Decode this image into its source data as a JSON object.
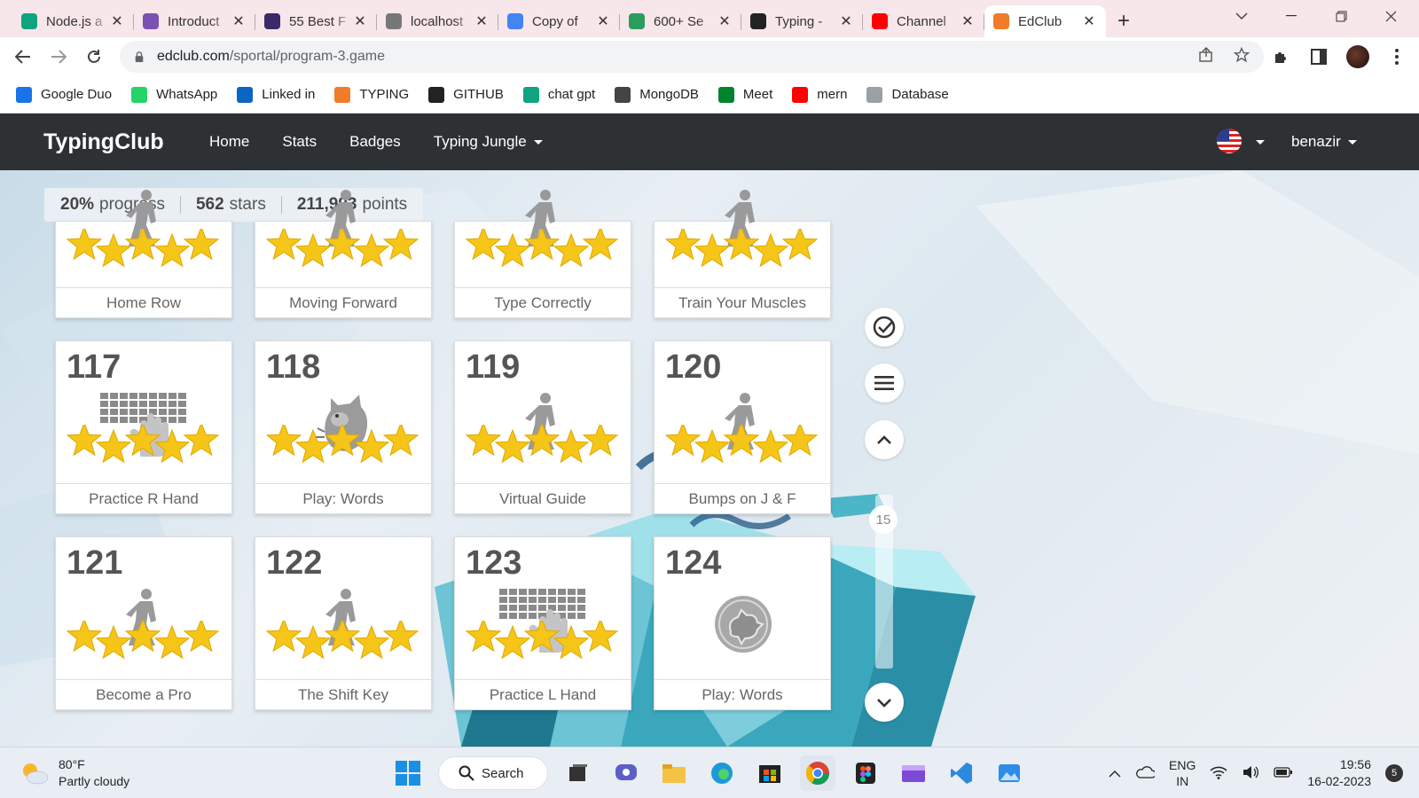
{
  "browser": {
    "tabs": [
      {
        "title": "Node.js a",
        "icon": "chatgpt-icon",
        "color": "#10a37f"
      },
      {
        "title": "Introduct",
        "icon": "bootstrap-icon",
        "color": "#7952b3"
      },
      {
        "title": "55 Best F",
        "icon": "colorlib-icon",
        "color": "#3b2a6b"
      },
      {
        "title": "localhost",
        "icon": "globe-icon",
        "color": "#777777"
      },
      {
        "title": "Copy of",
        "icon": "docs-icon",
        "color": "#4285f4"
      },
      {
        "title": "600+ Se",
        "icon": "feather-icon",
        "color": "#2a9d5c"
      },
      {
        "title": "Typing -",
        "icon": "wikipedia-icon",
        "color": "#222222"
      },
      {
        "title": "Channel",
        "icon": "youtube-icon",
        "color": "#ff0000"
      },
      {
        "title": "EdClub",
        "icon": "edclub-icon",
        "color": "#f07c2a",
        "active": true
      }
    ],
    "address": {
      "host": "edclub.com",
      "path": "/sportal/program-3.game"
    },
    "bookmarks": [
      {
        "label": "Google Duo",
        "icon": "duo-icon",
        "color": "#1a73e8"
      },
      {
        "label": "WhatsApp",
        "icon": "whatsapp-icon",
        "color": "#25d366"
      },
      {
        "label": "Linked in",
        "icon": "linkedin-icon",
        "color": "#0a66c2"
      },
      {
        "label": "TYPING",
        "icon": "edclub-icon",
        "color": "#f07c2a"
      },
      {
        "label": "GITHUB",
        "icon": "github-icon",
        "color": "#222222"
      },
      {
        "label": "chat gpt",
        "icon": "chatgpt-icon",
        "color": "#10a37f"
      },
      {
        "label": "MongoDB",
        "icon": "mongodb-icon",
        "color": "#444444"
      },
      {
        "label": "Meet",
        "icon": "meet-icon",
        "color": "#00832d"
      },
      {
        "label": "mern",
        "icon": "youtube-icon",
        "color": "#ff0000"
      },
      {
        "label": "Database",
        "icon": "bolt-icon",
        "color": "#9aa0a6"
      }
    ]
  },
  "site": {
    "brand": "TypingClub",
    "nav": [
      "Home",
      "Stats",
      "Badges",
      "Typing Jungle"
    ],
    "user": "benazir"
  },
  "stats": {
    "progress_value": "20%",
    "progress_label": "progress",
    "stars_value": "562",
    "stars_label": "stars",
    "points_value": "211,993",
    "points_label": "points"
  },
  "lessons_top_row": [
    {
      "label": "Home Row",
      "stars": 5
    },
    {
      "label": "Moving Forward",
      "stars": 5
    },
    {
      "label": "Type Correctly",
      "stars": 5
    },
    {
      "label": "Train Your Muscles",
      "stars": 5
    }
  ],
  "lessons": [
    {
      "number": "117",
      "label": "Practice R Hand",
      "art": "hand-keyboard",
      "stars": 5
    },
    {
      "number": "118",
      "label": "Play: Words",
      "art": "monster",
      "stars": 5
    },
    {
      "number": "119",
      "label": "Virtual Guide",
      "art": "walker",
      "stars": 5
    },
    {
      "number": "120",
      "label": "Bumps on J & F",
      "art": "walker",
      "stars": 5
    },
    {
      "number": "121",
      "label": "Become a Pro",
      "art": "walker",
      "stars": 5
    },
    {
      "number": "122",
      "label": "The Shift Key",
      "art": "walker",
      "stars": 5
    },
    {
      "number": "123",
      "label": "Practice L Hand",
      "art": "hand-keyboard",
      "stars": 5
    },
    {
      "number": "124",
      "label": "Play: Words",
      "art": "game-badge",
      "stars": 0
    }
  ],
  "scroller": {
    "page": "15"
  },
  "taskbar": {
    "weather_temp": "80°F",
    "weather_desc": "Partly cloudy",
    "search_label": "Search",
    "lang_top": "ENG",
    "lang_bottom": "IN",
    "time": "19:56",
    "date": "16-02-2023",
    "notifications": "5"
  },
  "colors": {
    "nav_bg": "#2d3134",
    "star": "#f5c518",
    "tabstrip": "#f7e6ea"
  }
}
